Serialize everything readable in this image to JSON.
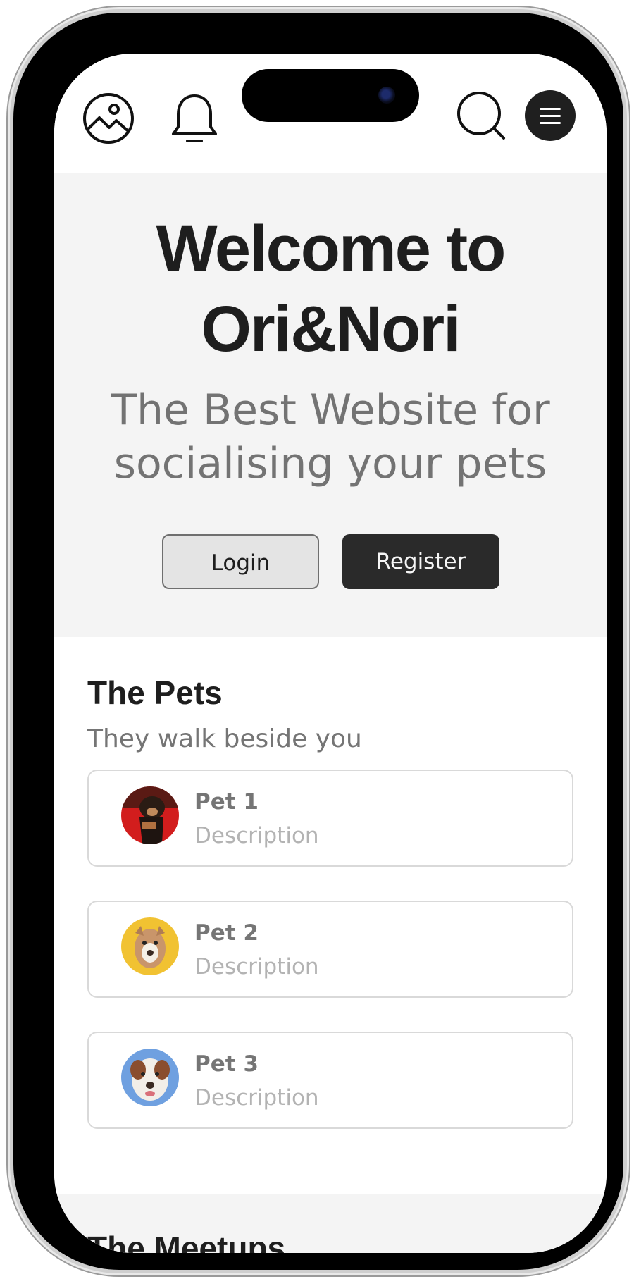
{
  "hero": {
    "title_line1": "Welcome to",
    "title_line2": "Ori&Nori",
    "subtitle_line1": "The Best Website for",
    "subtitle_line2": "socialising your pets",
    "login_label": "Login",
    "register_label": "Register"
  },
  "pets_section": {
    "heading": "The Pets",
    "tagline": "They walk beside you",
    "items": [
      {
        "name": "Pet 1",
        "description": "Description",
        "avatar_bg": "#d21d1d"
      },
      {
        "name": "Pet 2",
        "description": "Description",
        "avatar_bg": "#f1c232"
      },
      {
        "name": "Pet 3",
        "description": "Description",
        "avatar_bg": "#6fa0e0"
      }
    ]
  },
  "meetups_section": {
    "heading": "The Meetups"
  },
  "icons": [
    "image-icon",
    "bell-icon",
    "search-icon",
    "menu-icon"
  ],
  "colors": {
    "primary_dark": "#2a2a2a",
    "hero_bg": "#f4f4f4",
    "muted_text": "#757575"
  }
}
